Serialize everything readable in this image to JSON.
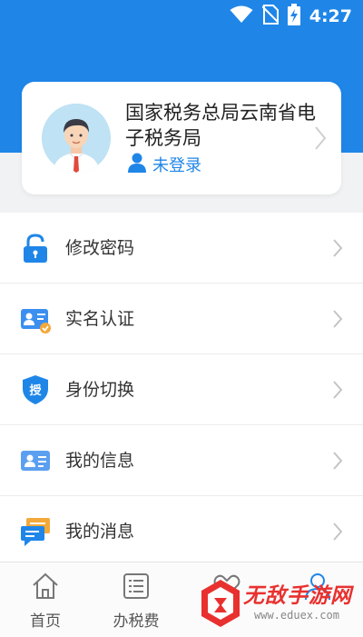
{
  "status_bar": {
    "time": "4:27",
    "icons": [
      "wifi-icon",
      "no-sim-icon",
      "battery-charging-icon"
    ]
  },
  "profile": {
    "org_name": "国家税务总局云南省电子税务局",
    "login_status": "未登录",
    "avatar_icon": "user-avatar",
    "login_icon": "person-icon"
  },
  "menu": {
    "items": [
      {
        "label": "修改密码",
        "icon": "lock-icon"
      },
      {
        "label": "实名认证",
        "icon": "id-card-verified-icon"
      },
      {
        "label": "身份切换",
        "icon": "shield-authorize-icon"
      },
      {
        "label": "我的信息",
        "icon": "contact-card-icon"
      },
      {
        "label": "我的消息",
        "icon": "message-bubble-icon"
      }
    ]
  },
  "tab_bar": {
    "tabs": [
      {
        "label": "首页",
        "icon": "home-icon"
      },
      {
        "label": "办税费",
        "icon": "list-document-icon"
      },
      {
        "label": "",
        "icon": "heart-hands-icon"
      },
      {
        "label": "",
        "icon": "person-outline-icon"
      }
    ]
  },
  "watermark": {
    "text": "无敌手游网",
    "url": "www.eduex.com"
  },
  "colors": {
    "primary": "#1f86e8",
    "background": "#f1f2f4",
    "watermark": "#e8312f"
  }
}
